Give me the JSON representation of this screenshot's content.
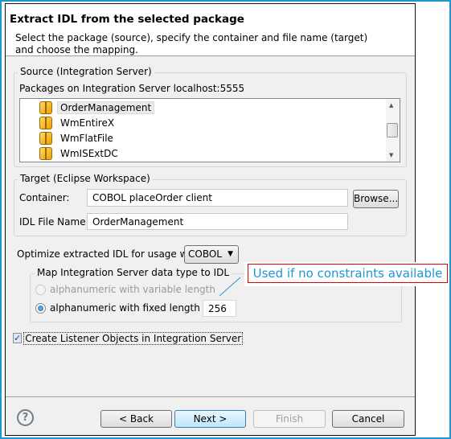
{
  "header": {
    "title": "Extract IDL from the selected package",
    "description": "Select the package (source), specify the container and file name (target) and choose the mapping."
  },
  "source": {
    "legend": "Source (Integration Server)",
    "label": "Packages on Integration Server localhost:5555",
    "packages": [
      {
        "name": "OrderManagement",
        "selected": true
      },
      {
        "name": "WmEntireX"
      },
      {
        "name": "WmFlatFile"
      },
      {
        "name": "WmISExtDC"
      }
    ],
    "icon": "package-icon"
  },
  "target": {
    "legend": "Target (Eclipse Workspace)",
    "container_label": "Container:",
    "container_value": "COBOL placeOrder client",
    "browse_label": "Browse...",
    "idl_label": "IDL File Name:",
    "idl_value": "OrderManagement"
  },
  "optimize": {
    "label": "Optimize extracted IDL for usage with:",
    "selected": "COBOL"
  },
  "mapping": {
    "legend": "Map Integration Server data type to IDL",
    "option_variable": "alphanumeric with variable length",
    "option_fixed": "alphanumeric with fixed length of",
    "fixed_length": "256",
    "selected": "fixed"
  },
  "listener": {
    "label": "Create Listener Objects in Integration Server",
    "checked": true
  },
  "callout": {
    "text": "Used if no constraints available",
    "border_color": "#e00000",
    "text_color": "#1c97d3"
  },
  "buttons": {
    "back": "< Back",
    "next": "Next >",
    "finish": "Finish",
    "cancel": "Cancel",
    "help": "?"
  }
}
